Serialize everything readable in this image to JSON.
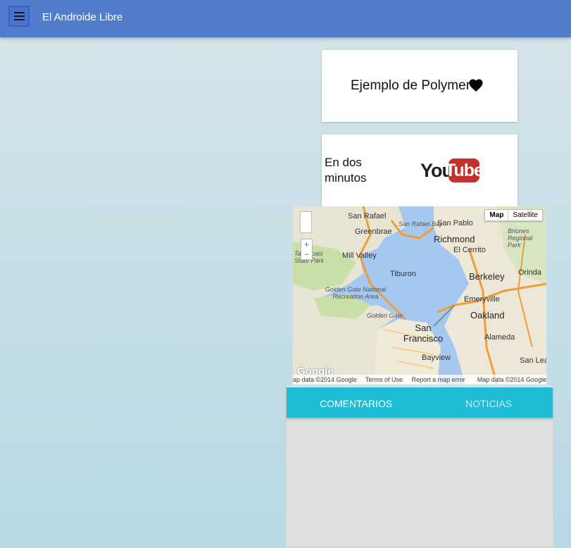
{
  "toolbar": {
    "title": "El Androide Libre",
    "menu_icon": "hamburger-menu-icon"
  },
  "cards": {
    "polymer": {
      "text": "Ejemplo de Polymer",
      "icon": "heart-icon"
    },
    "video": {
      "text": "En dos minutos",
      "logo_you": "You",
      "logo_tube": "Tube"
    }
  },
  "map": {
    "toggle_map": "Map",
    "toggle_satellite": "Satellite",
    "zoom_in": "+",
    "zoom_out": "−",
    "logo": "Google",
    "footer_data": "ap data ©2014 Google",
    "footer_terms": "Terms of Use",
    "footer_report": "Report a map error",
    "footer_right": "Map data ©2014 Google",
    "labels": {
      "san_rafael": "San Rafael",
      "greenbrae": "Greenbrae",
      "san_pablo": "San Pablo",
      "richmond": "Richmond",
      "el_cerrito": "El Cerrito",
      "briones": "Briones Regional Park",
      "mill_valley": "Mill Valley",
      "tamalpais": "Tamalpais State Park",
      "tiburon": "Tiburon",
      "berkeley": "Berkeley",
      "orinda": "Orinda",
      "golden_gate_nra": "Golden Gate National Recreation Area",
      "golden_gate": "Golden Gate",
      "emeryville": "Emeryville",
      "oakland": "Oakland",
      "san_francisco": "San Francisco",
      "alameda": "Alameda",
      "bayview": "Bayview",
      "san_leandro": "San Lea",
      "san_rafael_bay": "San Rafael Bay"
    }
  },
  "tabs": {
    "comentarios": "COMENTARIOS",
    "noticias": "NOTICIAS"
  },
  "colors": {
    "toolbar": "#527dcc",
    "tabs": "#1fbcd6",
    "youtube_red": "#c4302b"
  }
}
